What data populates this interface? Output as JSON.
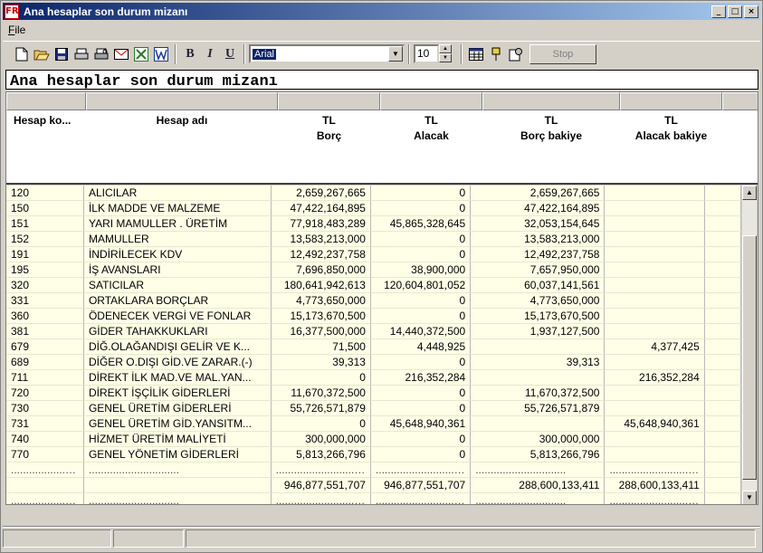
{
  "window": {
    "title": "Ana hesaplar son durum mizanı",
    "icon_label": "FR",
    "minimize": "_",
    "maximize": "□",
    "close": "×"
  },
  "menu": {
    "file": "File"
  },
  "toolbar": {
    "icons": [
      "new-icon",
      "open-icon",
      "save-icon",
      "print-icon",
      "print-preview-icon",
      "mail-icon",
      "excel-icon",
      "word-icon"
    ],
    "bold": "B",
    "italic": "I",
    "underline": "U",
    "font_name": "Arial",
    "font_size": "10",
    "stop_label": "Stop"
  },
  "report": {
    "title": "Ana hesaplar son durum mizanı"
  },
  "columns": [
    {
      "line1": "Hesap ko...",
      "line2": ""
    },
    {
      "line1": "Hesap adı",
      "line2": ""
    },
    {
      "line1": "TL",
      "line2": "Borç"
    },
    {
      "line1": "TL",
      "line2": "Alacak"
    },
    {
      "line1": "TL",
      "line2": "Borç bakiye"
    },
    {
      "line1": "TL",
      "line2": "Alacak bakiye"
    }
  ],
  "rows": [
    [
      "120",
      "ALICILAR",
      "2,659,267,665",
      "0",
      "2,659,267,665",
      ""
    ],
    [
      "150",
      "İLK MADDE VE MALZEME",
      "47,422,164,895",
      "0",
      "47,422,164,895",
      ""
    ],
    [
      "151",
      "YARI MAMULLER . ÜRETİM",
      "77,918,483,289",
      "45,865,328,645",
      "32,053,154,645",
      ""
    ],
    [
      "152",
      "MAMULLER",
      "13,583,213,000",
      "0",
      "13,583,213,000",
      ""
    ],
    [
      "191",
      "İNDİRİLECEK KDV",
      "12,492,237,758",
      "0",
      "12,492,237,758",
      ""
    ],
    [
      "195",
      "İŞ AVANSLARI",
      "7,696,850,000",
      "38,900,000",
      "7,657,950,000",
      ""
    ],
    [
      "320",
      "SATICILAR",
      "180,641,942,613",
      "120,604,801,052",
      "60,037,141,561",
      ""
    ],
    [
      "331",
      "ORTAKLARA BORÇLAR",
      "4,773,650,000",
      "0",
      "4,773,650,000",
      ""
    ],
    [
      "360",
      "ÖDENECEK VERGİ VE FONLAR",
      "15,173,670,500",
      "0",
      "15,173,670,500",
      ""
    ],
    [
      "381",
      "GİDER TAHAKKUKLARI",
      "16,377,500,000",
      "14,440,372,500",
      "1,937,127,500",
      ""
    ],
    [
      "679",
      "DİĞ.OLAĞANDIŞI GELİR VE K...",
      "71,500",
      "4,448,925",
      "",
      "4,377,425"
    ],
    [
      "689",
      "DİĞER O.DIŞI GİD.VE ZARAR.(-)",
      "39,313",
      "0",
      "39,313",
      ""
    ],
    [
      "711",
      "DİREKT İLK MAD.VE MAL.YAN...",
      "0",
      "216,352,284",
      "",
      "216,352,284"
    ],
    [
      "720",
      "DİREKT İŞÇİLİK GİDERLERİ",
      "11,670,372,500",
      "0",
      "11,670,372,500",
      ""
    ],
    [
      "730",
      "GENEL ÜRETİM GİDERLERİ",
      "55,726,571,879",
      "0",
      "55,726,571,879",
      ""
    ],
    [
      "731",
      "GENEL ÜRETİM GİD.YANSITM...",
      "0",
      "45,648,940,361",
      "",
      "45,648,940,361"
    ],
    [
      "740",
      "HİZMET ÜRETİM MALİYETİ",
      "300,000,000",
      "0",
      "300,000,000",
      ""
    ],
    [
      "770",
      "GENEL YÖNETİM GİDERLERİ",
      "5,813,266,796",
      "0",
      "5,813,266,796",
      ""
    ]
  ],
  "dots": "..............................",
  "totals": [
    "",
    "",
    "946,877,551,707",
    "946,877,551,707",
    "288,600,133,411",
    "288,600,133,411"
  ]
}
